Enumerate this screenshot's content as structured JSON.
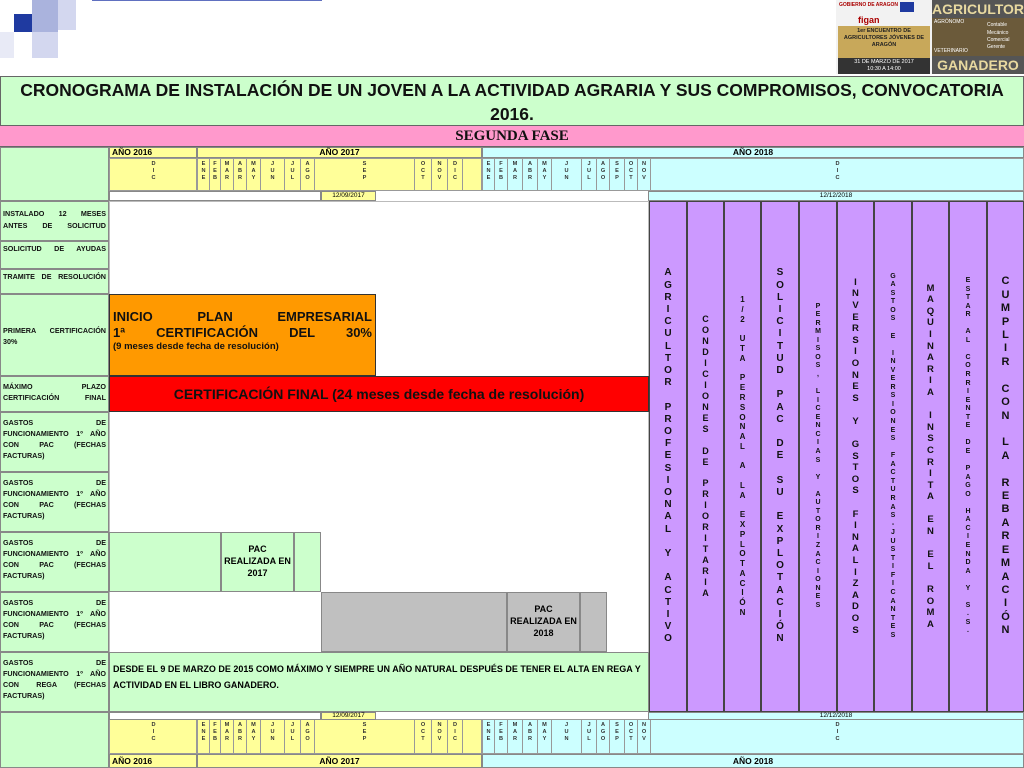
{
  "title": "CRONOGRAMA DE INSTALACIÓN DE UN JOVEN A LA ACTIVIDAD AGRARIA Y SUS COMPROMISOS, CONVOCATORIA 2016.",
  "fase": "SEGUNDA FASE",
  "years": {
    "y2016": "AÑO 2016",
    "y2017": "AÑO 2017",
    "y2018": "AÑO 2018"
  },
  "months_2016": [
    "D I C"
  ],
  "months_2017": [
    "E N E",
    "F E B",
    "M A R",
    "A B R",
    "M A Y",
    "J U N",
    "J U L",
    "A G O",
    "S E P",
    "O C T",
    "N O V",
    "D I C"
  ],
  "months_2018": [
    "E N E",
    "F E B",
    "M A R",
    "A B R",
    "M A Y",
    "J U N",
    "J U L",
    "A G O",
    "S E P",
    "O C T",
    "N O V",
    "D I C"
  ],
  "dates": {
    "d1": "12/09/2017",
    "d2": "12/12/2018"
  },
  "row_labels": [
    "INSTALADO 12 MESES ANTES DE SOLICITUD",
    "SOLICITUD DE AYUDAS",
    "TRAMITE DE RESOLUCIÓN",
    "PRIMERA CERTIFICACIÓN 30%",
    "MÁXIMO PLAZO CERTIFICACIÓN FINAL",
    "GASTOS DE FUNCIONAMIENTO 1º AÑO CON PAC (FECHAS FACTURAS)",
    "GASTOS DE FUNCIONAMIENTO 1º AÑO CON PAC (FECHAS FACTURAS)",
    "GASTOS DE FUNCIONAMIENTO 1º AÑO CON PAC (FECHAS FACTURAS)",
    "GASTOS DE FUNCIONAMIENTO 1º AÑO CON PAC (FECHAS FACTURAS)",
    "GASTOS DE FUNCIONAMIENTO 1º AÑO CON REGA (FECHAS FACTURAS)"
  ],
  "inicio": {
    "line1": "INICIO PLAN EMPRESARIAL",
    "line2": "1ª CERTIFICACIÓN DEL 30%",
    "line3": "(9 meses desde fecha de resolución)"
  },
  "certificacion_final": "CERTIFICACIÓN FINAL (24 meses desde fecha de resolución)",
  "pac2017": "PAC REALIZADA EN 2017",
  "pac2018": "PAC REALIZADA EN 2018",
  "rega_note": "DESDE EL 9 DE MARZO DE 2015 COMO MÁXIMO Y SIEMPRE UN AÑO NATURAL DESPUÉS DE TENER EL ALTA EN REGA Y ACTIVIDAD EN EL LIBRO GANADERO.",
  "vertical_columns": [
    {
      "text": "AGRICULTOR PROFESIONAL Y ACTIVO",
      "color": "#cc99ff"
    },
    {
      "text": "CONDICIONES DE PRIORITARIA",
      "color": "#cc99ff"
    },
    {
      "text": "1/2 UTA PERSONAL A LA EXPLOTACIÓN",
      "color": "#cc99ff"
    },
    {
      "text": "SOLICITUD PAC DE SU EXPLOTACIÓN",
      "color": "#cc99ff"
    },
    {
      "text": "PERMISOS, LICENCIAS Y AUTORIZACIONES",
      "color": "#cc99ff"
    },
    {
      "text": "INVERSIONES Y GSTOS FINALIZADOS",
      "color": "#cc99ff"
    },
    {
      "text": "GASTOS E INVERSIONES FACTURAS-JUSTIFICANTES",
      "color": "#cc99ff"
    },
    {
      "text": "MAQUINARIA INSCRITA EN EL ROMA",
      "color": "#cc99ff"
    },
    {
      "text": "ESTAR AL CORRIENTE DE PAGO HACIENDA Y S.S.",
      "color": "#cc99ff"
    },
    {
      "text": "CUMPLIR CON LA REBAREMACIÓN",
      "color": "#cc99ff"
    }
  ],
  "logo": {
    "gov_text": "GOBIERNO DE ARAGON",
    "figan": "figan",
    "event_line1": "1er ENCUENTRO DE",
    "event_line2": "AGRICULTORES JÓVENES DE",
    "event_line3": "ARAGÓN",
    "event_date": "31 DE MARZO DE 2017",
    "event_time": "10:30 A 14:00",
    "agricultor": "AGRICULTOR",
    "ganadero": "GANADERO",
    "side_words": [
      "AGRÓNOMO",
      "Contable",
      "Mecánico",
      "Comercial",
      "Gerente",
      "VETERINARIO"
    ]
  },
  "colors": {
    "green": "#ccffcc",
    "pink": "#ff99cc",
    "yellow": "#ffff99",
    "cyan": "#ccffff",
    "orange": "#ff9900",
    "red": "#ff0000",
    "lilac": "#cc99ff",
    "gray": "#c0c0c0"
  }
}
